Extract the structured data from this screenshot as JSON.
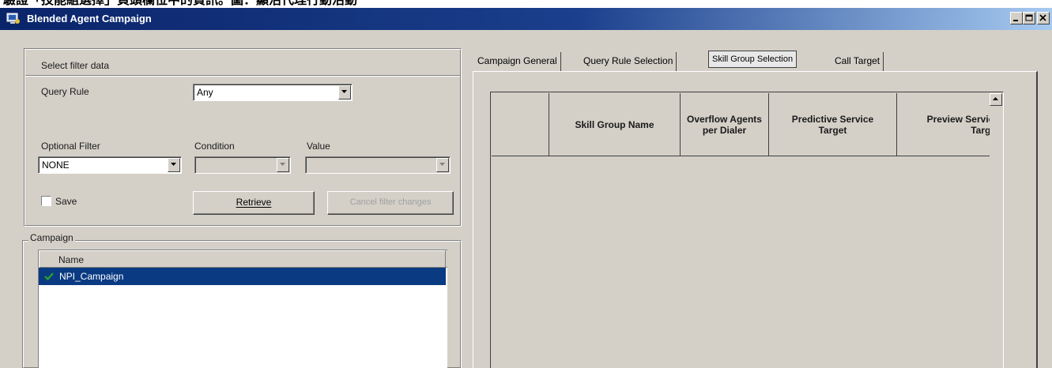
{
  "caption": {
    "text": "驗證「技能組選擇」頁頭欄位中的資訊。圖：顯活代理行動活動"
  },
  "window": {
    "title": "Blended Agent Campaign",
    "controls": {
      "minimize": "_",
      "maximize": "□",
      "close": "x"
    }
  },
  "filter": {
    "group_label": "Select filter data",
    "query_rule_label": "Query Rule",
    "query_rule_value": "Any",
    "optional_filter_label": "Optional Filter",
    "optional_filter_value": "NONE",
    "condition_label": "Condition",
    "condition_value": "",
    "value_label": "Value",
    "value_value": "",
    "save_label": "Save",
    "save_checked": false,
    "retrieve_label": "Retrieve",
    "cancel_label": "Cancel filter changes"
  },
  "campaign": {
    "group_label": "Campaign",
    "column_name": "Name",
    "items": [
      {
        "name": "NPI_Campaign",
        "selected": true
      }
    ]
  },
  "tabs": [
    {
      "label": "Campaign General",
      "active": false
    },
    {
      "label": "Query Rule Selection",
      "active": false
    },
    {
      "label": "Skill Group Selection",
      "active": true
    },
    {
      "label": "Call Target",
      "active": false
    }
  ],
  "skill_group_grid": {
    "columns": [
      "",
      "Skill Group Name",
      "Overflow Agents per Dialer",
      "Predictive Service Target",
      "Preview Service Target"
    ],
    "rows": []
  },
  "colors": {
    "window_bg": "#d4d0c8",
    "titlebar": "#0a246a",
    "selection": "#0a3a82",
    "check": "#2ca02c"
  }
}
